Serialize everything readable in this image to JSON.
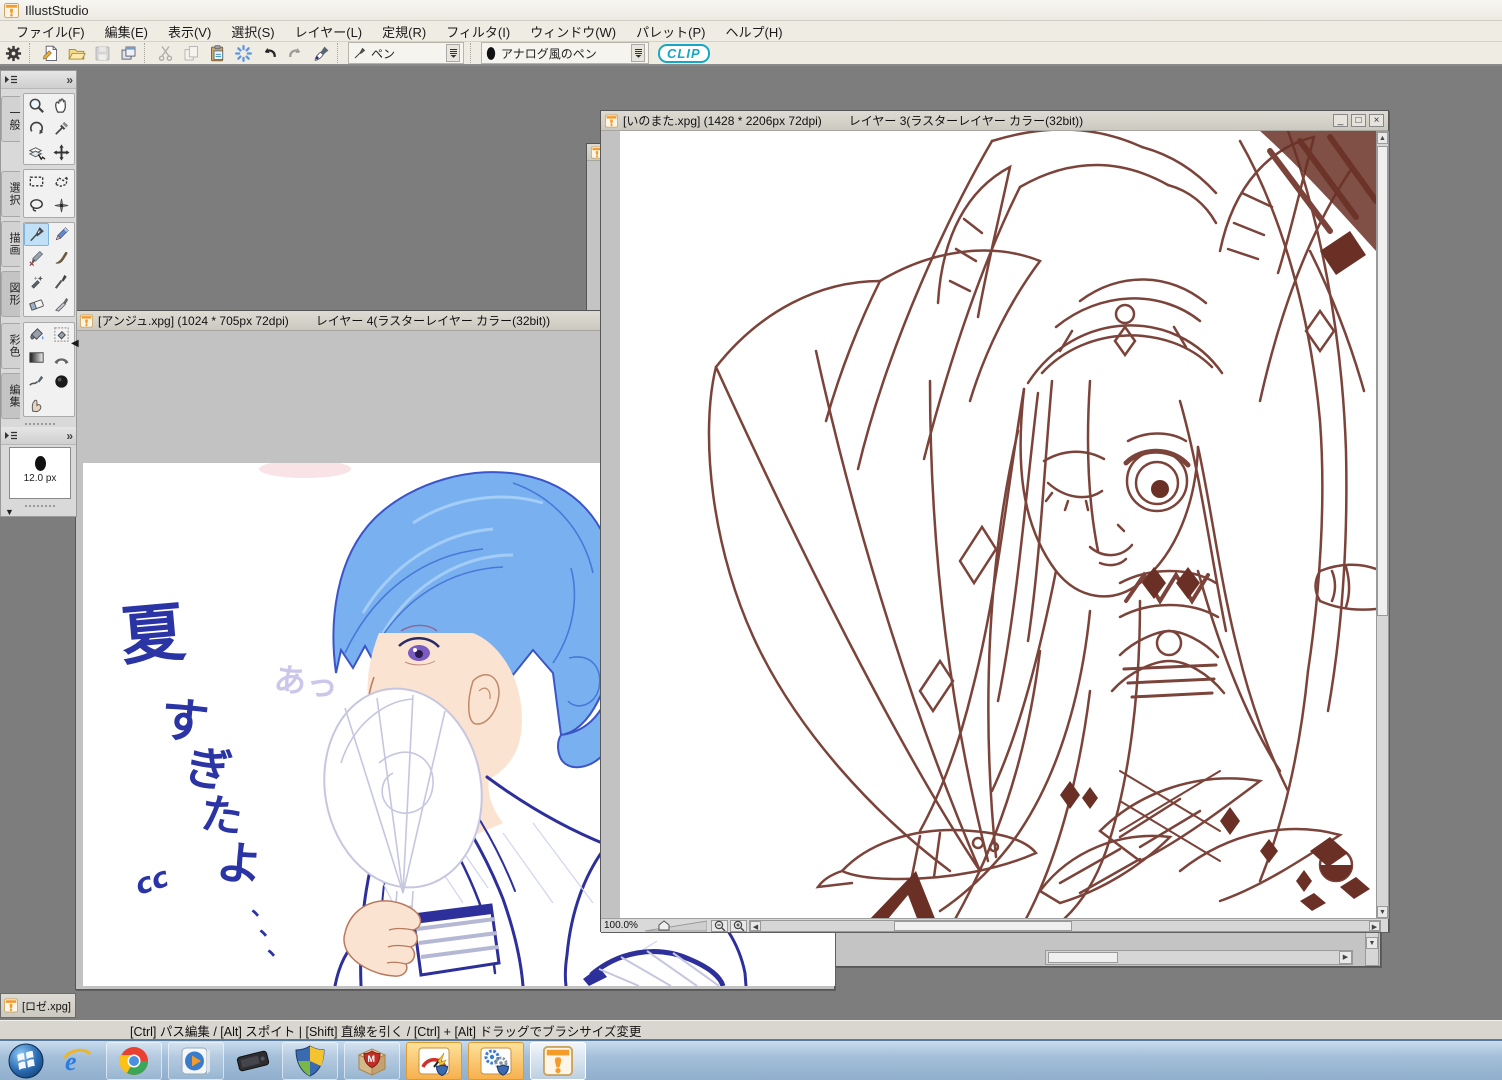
{
  "app": {
    "title": "IllustStudio"
  },
  "menu": {
    "items": [
      {
        "label": "ファイル(F)"
      },
      {
        "label": "編集(E)"
      },
      {
        "label": "表示(V)"
      },
      {
        "label": "選択(S)"
      },
      {
        "label": "レイヤー(L)"
      },
      {
        "label": "定規(R)"
      },
      {
        "label": "フィルタ(I)"
      },
      {
        "label": "ウィンドウ(W)"
      },
      {
        "label": "パレット(P)"
      },
      {
        "label": "ヘルプ(H)"
      }
    ]
  },
  "toolbar": {
    "icons": [
      "settings-gear",
      "new-document",
      "open-folder",
      "save",
      "save-all",
      "cut",
      "copy",
      "paste",
      "refresh-spinner",
      "undo",
      "redo",
      "ink-pen"
    ],
    "tool_field": {
      "icon": "pen-tool",
      "label": "ペン"
    },
    "preset_field": {
      "icon": "brush-tip-dot",
      "label": "アナログ風のペン"
    },
    "clip_logo": "CLIP"
  },
  "palette": {
    "tabs": [
      "一般",
      "選択",
      "描画",
      "図形",
      "彩色",
      "編集"
    ],
    "groups": {
      "general": [
        "zoom",
        "hand",
        "rotate-canvas",
        "eyedropper",
        "layer-select",
        "move"
      ],
      "selection": [
        "rect-select",
        "polyline-select",
        "lasso",
        "magic-wand"
      ],
      "drawing": [
        "pen",
        "pencil",
        "marker-pen",
        "brush",
        "airbrush",
        "fude-brush",
        "eraser",
        "knife"
      ],
      "coloring": [
        "fill-bucket",
        "enclosed-fill",
        "gradient",
        "arch-tool",
        "line-smooth",
        "shade-circle",
        "blend-finger"
      ]
    },
    "selected_tool": "pen",
    "brush_preview": {
      "size": "12.0 px"
    }
  },
  "windows": {
    "anju": {
      "title_file": "[アンジュ.xpg] (1024 * 705px 72dpi)",
      "title_layer": "レイヤー 4(ラスターレイヤー カラー(32bit))"
    },
    "inomata": {
      "title_file": "[いのまた.xpg] (1428 * 2206px 72dpi)",
      "title_layer": "レイヤー 3(ラスターレイヤー カラー(32bit))",
      "zoom_level": "100.0%",
      "controls": {
        "minimize": "_",
        "maximize": "□",
        "close": "×"
      }
    },
    "roze": {
      "title_file": "[ロゼ.xpg]"
    }
  },
  "canvas_anju": {
    "handwriting": {
      "line": "夏すぎたよ、、、",
      "chars": [
        "夏",
        "す",
        "ぎ",
        "た",
        "よ"
      ],
      "dots": [
        "、",
        "、",
        "、"
      ],
      "scribble": "cc",
      "faint_note": "あっ"
    }
  },
  "statusbar": {
    "text": "[Ctrl] パス編集 / [Alt] スポイト | [Shift] 直線を引く / [Ctrl] + [Alt] ドラッグでブラシサイズ変更"
  },
  "taskbar": {
    "items": [
      {
        "name": "start"
      },
      {
        "name": "internet-explorer"
      },
      {
        "name": "chrome"
      },
      {
        "name": "media-player"
      },
      {
        "name": "pen-tablet"
      },
      {
        "name": "security-shield"
      },
      {
        "name": "antivirus-box"
      },
      {
        "name": "tuneup-utility"
      },
      {
        "name": "system-utility"
      },
      {
        "name": "illuststudio",
        "active": true
      }
    ]
  },
  "colors": {
    "workspace": "#7d7d7d",
    "selected_tool_bg": "#bfe0f7",
    "sepia_line": "#7b4339",
    "sepia_fill": "#6a3026",
    "hair_blue": "#79b1f0",
    "ink_blue": "#2b34a4",
    "kimono_line": "#2d2f9a",
    "fan_sketch": "#c6c6e0",
    "taskbar_top": "#c9dcee",
    "taskbar_bottom": "#8fafcd",
    "clip_teal": "#17a7c4",
    "icon_orange": "#f49b2a"
  }
}
